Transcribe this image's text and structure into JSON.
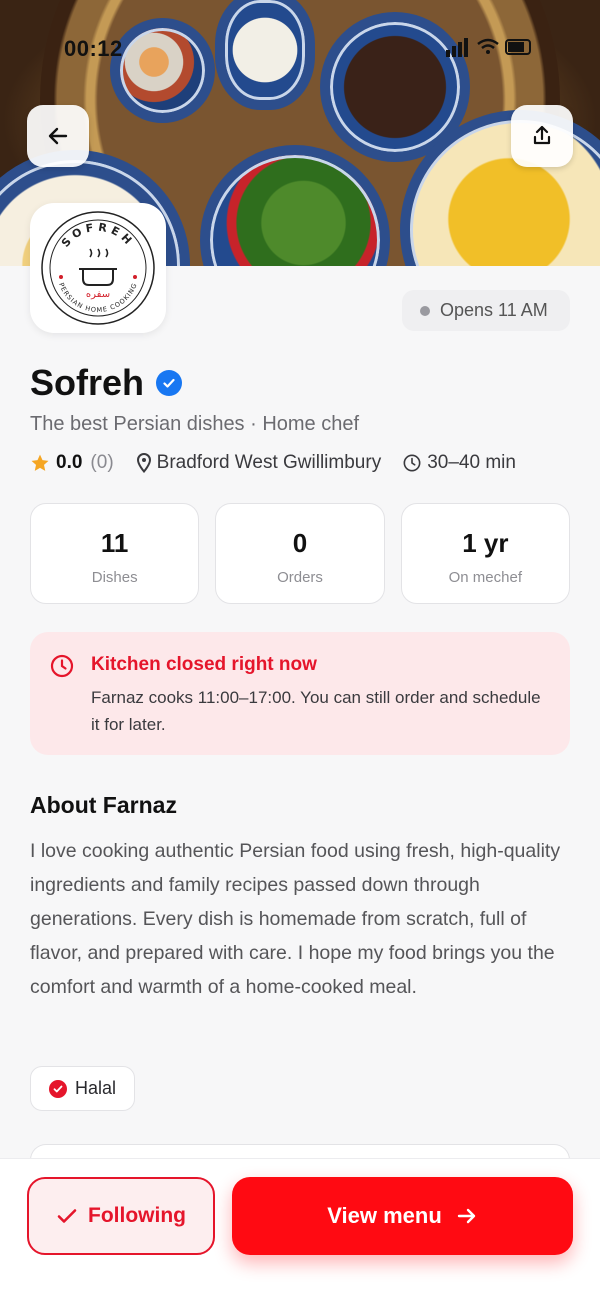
{
  "status_bar": {
    "time": "00:12"
  },
  "kitchen": {
    "name": "Sofreh",
    "tagline": "The best Persian dishes · Home chef",
    "rating": "0.0",
    "rating_count": "(0)",
    "location": "Bradford West Gwillimbury",
    "delivery_time": "30–40 min",
    "opens": "Opens 11 AM"
  },
  "logo": {
    "name_text": "SOFREH",
    "subtitle_text": "PERSIAN HOME COOKING",
    "farsi_text": "سفره"
  },
  "stats": [
    {
      "value": "11",
      "label": "Dishes"
    },
    {
      "value": "0",
      "label": "Orders"
    },
    {
      "value": "1 yr",
      "label": "On mechef"
    }
  ],
  "alert": {
    "title": "Kitchen closed right now",
    "body": "Farnaz cooks 11:00–17:00. You can still order and schedule it for later."
  },
  "about": {
    "title": "About Farnaz",
    "text": "I love cooking authentic Persian food using fresh, high-quality ingredients and family recipes passed down through generations. Every dish is homemade from scratch, full of flavor, and prepared with care. I hope my food brings you the comfort and warmth of a home-cooked meal."
  },
  "tags": [
    {
      "label": "Halal"
    }
  ],
  "actions": {
    "follow_label": "Following",
    "menu_label": "View menu"
  },
  "colors": {
    "accent": "#ff0a12",
    "alert_text": "#e5152b",
    "alert_bg": "#fde8ea",
    "verified": "#1877f2",
    "star": "#f5a623"
  },
  "icons": [
    "back-arrow-icon",
    "share-icon",
    "verified-icon",
    "star-icon",
    "location-pin-icon",
    "clock-icon",
    "check-icon",
    "arrow-right-icon"
  ]
}
